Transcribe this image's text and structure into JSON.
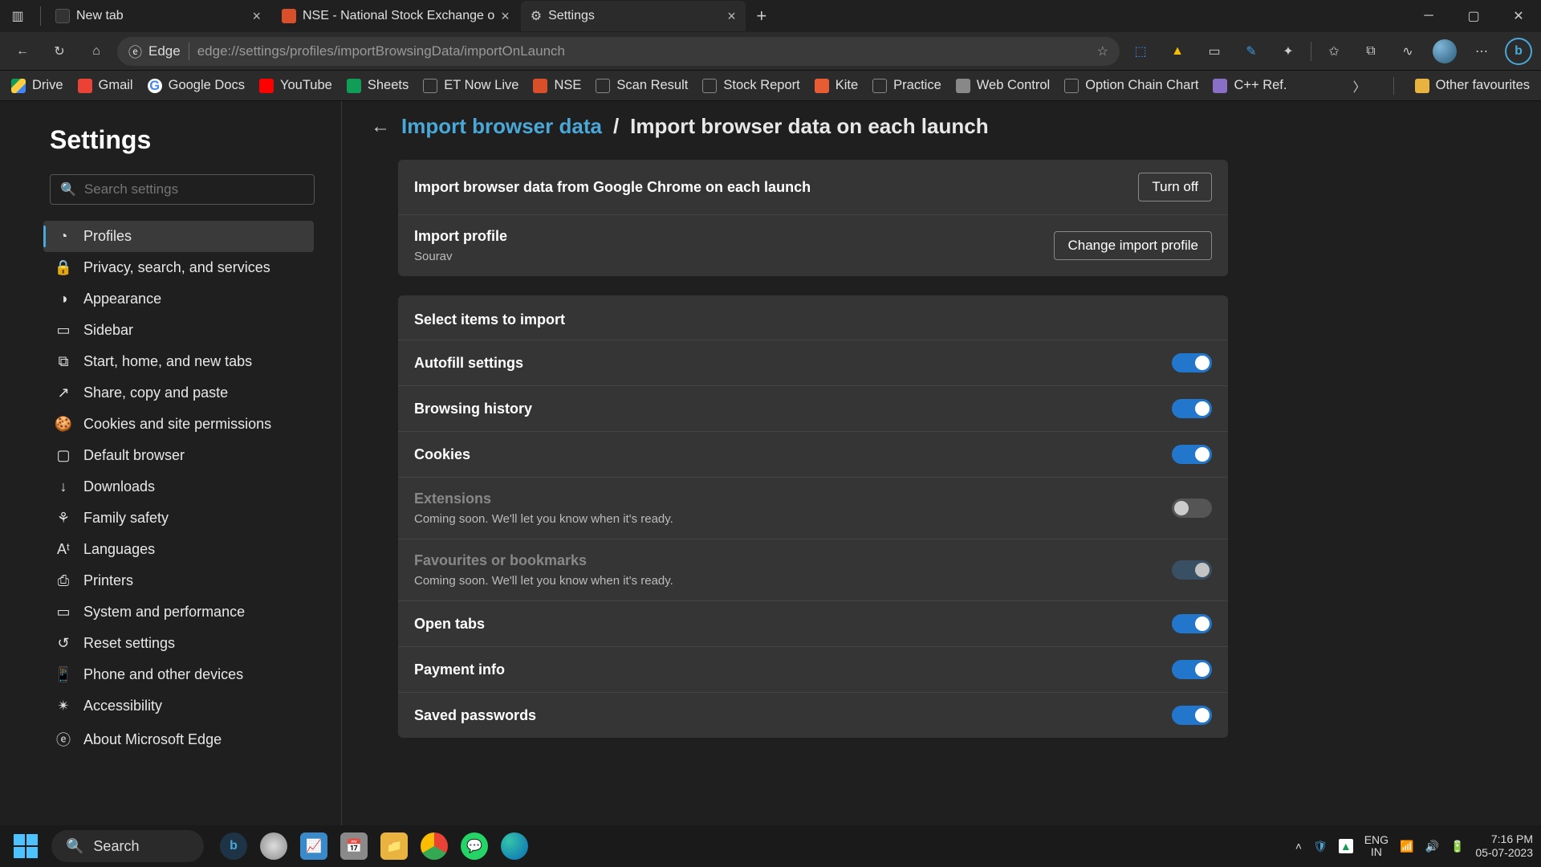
{
  "titlebar": {
    "tabs": [
      {
        "label": "New tab",
        "favicon": "#333"
      },
      {
        "label": "NSE - National Stock Exchange o",
        "favicon": "#d94f2a"
      },
      {
        "label": "Settings",
        "favicon": "gear"
      }
    ]
  },
  "addressbar": {
    "scheme_label": "Edge",
    "url": "edge://settings/profiles/importBrowsingData/importOnLaunch"
  },
  "bookmarks": {
    "items": [
      {
        "label": "Drive",
        "color": "linear-gradient(135deg,#0f9d58 33%,#ffcd40 33% 66%,#4285f4 66%)"
      },
      {
        "label": "Gmail",
        "color": "#ea4335"
      },
      {
        "label": "Google Docs",
        "color": "#4285f4"
      },
      {
        "label": "YouTube",
        "color": "#ff0000"
      },
      {
        "label": "Sheets",
        "color": "#0f9d58"
      },
      {
        "label": "ET Now Live",
        "color": "#777"
      },
      {
        "label": "NSE",
        "color": "#d94f2a"
      },
      {
        "label": "Scan Result",
        "color": "#777"
      },
      {
        "label": "Stock Report",
        "color": "#777"
      },
      {
        "label": "Kite",
        "color": "#e85c33"
      },
      {
        "label": "Practice",
        "color": "#777"
      },
      {
        "label": "Web Control",
        "color": "#888"
      },
      {
        "label": "Option Chain Chart",
        "color": "#777"
      },
      {
        "label": "C++ Ref.",
        "color": "#8a6fc7"
      }
    ],
    "other": "Other favourites"
  },
  "sidebar": {
    "title": "Settings",
    "search_placeholder": "Search settings",
    "items": [
      {
        "label": "Profiles",
        "icon": "◔"
      },
      {
        "label": "Privacy, search, and services",
        "icon": "🔒"
      },
      {
        "label": "Appearance",
        "icon": "◑"
      },
      {
        "label": "Sidebar",
        "icon": "▭"
      },
      {
        "label": "Start, home, and new tabs",
        "icon": "⧉"
      },
      {
        "label": "Share, copy and paste",
        "icon": "↗"
      },
      {
        "label": "Cookies and site permissions",
        "icon": "🍪"
      },
      {
        "label": "Default browser",
        "icon": "▢"
      },
      {
        "label": "Downloads",
        "icon": "↓"
      },
      {
        "label": "Family safety",
        "icon": "⚘"
      },
      {
        "label": "Languages",
        "icon": "Aᵗ"
      },
      {
        "label": "Printers",
        "icon": "⎙"
      },
      {
        "label": "System and performance",
        "icon": "▭"
      },
      {
        "label": "Reset settings",
        "icon": "↺"
      },
      {
        "label": "Phone and other devices",
        "icon": "📱"
      },
      {
        "label": "Accessibility",
        "icon": "✴"
      },
      {
        "label": "About Microsoft Edge",
        "icon": "ⓔ"
      }
    ]
  },
  "breadcrumb": {
    "link": "Import browser data",
    "current": "Import browser data on each launch"
  },
  "panel1": {
    "row1_title": "Import browser data from Google Chrome on each launch",
    "row1_btn": "Turn off",
    "row2_title": "Import profile",
    "row2_value": "Sourav",
    "row2_btn": "Change import profile"
  },
  "panel2": {
    "header": "Select items to import",
    "coming_soon": "Coming soon. We'll let you know when it's ready.",
    "items": [
      {
        "label": "Autofill settings",
        "state": "on"
      },
      {
        "label": "Browsing history",
        "state": "on"
      },
      {
        "label": "Cookies",
        "state": "on"
      },
      {
        "label": "Extensions",
        "state": "off",
        "disabled": true
      },
      {
        "label": "Favourites or bookmarks",
        "state": "on-disabled",
        "disabled": true
      },
      {
        "label": "Open tabs",
        "state": "on"
      },
      {
        "label": "Payment info",
        "state": "on"
      },
      {
        "label": "Saved passwords",
        "state": "on"
      }
    ]
  },
  "taskbar": {
    "search": "Search",
    "lang_top": "ENG",
    "lang_bottom": "IN",
    "time": "7:16 PM",
    "date": "05-07-2023"
  }
}
